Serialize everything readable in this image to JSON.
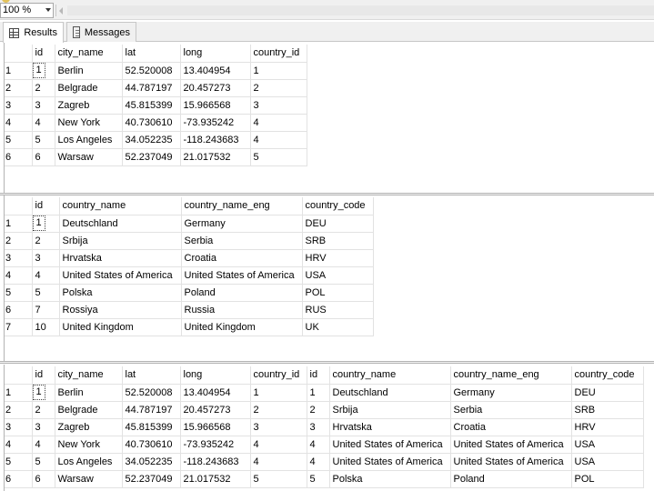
{
  "zoom": {
    "value": "100 %"
  },
  "tabs": {
    "results": "Results",
    "messages": "Messages"
  },
  "grid1": {
    "columns": [
      "",
      "id",
      "city_name",
      "lat",
      "long",
      "country_id"
    ],
    "rows": [
      [
        "1",
        "1",
        "Berlin",
        "52.520008",
        "13.404954",
        "1"
      ],
      [
        "2",
        "2",
        "Belgrade",
        "44.787197",
        "20.457273",
        "2"
      ],
      [
        "3",
        "3",
        "Zagreb",
        "45.815399",
        "15.966568",
        "3"
      ],
      [
        "4",
        "4",
        "New York",
        "40.730610",
        "-73.935242",
        "4"
      ],
      [
        "5",
        "5",
        "Los Angeles",
        "34.052235",
        "-118.243683",
        "4"
      ],
      [
        "6",
        "6",
        "Warsaw",
        "52.237049",
        "21.017532",
        "5"
      ]
    ]
  },
  "grid2": {
    "columns": [
      "",
      "id",
      "country_name",
      "country_name_eng",
      "country_code"
    ],
    "rows": [
      [
        "1",
        "1",
        "Deutschland",
        "Germany",
        "DEU"
      ],
      [
        "2",
        "2",
        "Srbija",
        "Serbia",
        "SRB"
      ],
      [
        "3",
        "3",
        "Hrvatska",
        "Croatia",
        "HRV"
      ],
      [
        "4",
        "4",
        "United States of America",
        "United States of America",
        "USA"
      ],
      [
        "5",
        "5",
        "Polska",
        "Poland",
        "POL"
      ],
      [
        "6",
        "7",
        "Rossiya",
        "Russia",
        "RUS"
      ],
      [
        "7",
        "10",
        "United Kingdom",
        "United Kingdom",
        "UK"
      ]
    ]
  },
  "grid3": {
    "columns": [
      "",
      "id",
      "city_name",
      "lat",
      "long",
      "country_id",
      "id",
      "country_name",
      "country_name_eng",
      "country_code"
    ],
    "rows": [
      [
        "1",
        "1",
        "Berlin",
        "52.520008",
        "13.404954",
        "1",
        "1",
        "Deutschland",
        "Germany",
        "DEU"
      ],
      [
        "2",
        "2",
        "Belgrade",
        "44.787197",
        "20.457273",
        "2",
        "2",
        "Srbija",
        "Serbia",
        "SRB"
      ],
      [
        "3",
        "3",
        "Zagreb",
        "45.815399",
        "15.966568",
        "3",
        "3",
        "Hrvatska",
        "Croatia",
        "HRV"
      ],
      [
        "4",
        "4",
        "New York",
        "40.730610",
        "-73.935242",
        "4",
        "4",
        "United States of America",
        "United States of America",
        "USA"
      ],
      [
        "5",
        "5",
        "Los Angeles",
        "34.052235",
        "-118.243683",
        "4",
        "4",
        "United States of America",
        "United States of America",
        "USA"
      ],
      [
        "6",
        "6",
        "Warsaw",
        "52.237049",
        "21.017532",
        "5",
        "5",
        "Polska",
        "Poland",
        "POL"
      ]
    ]
  }
}
